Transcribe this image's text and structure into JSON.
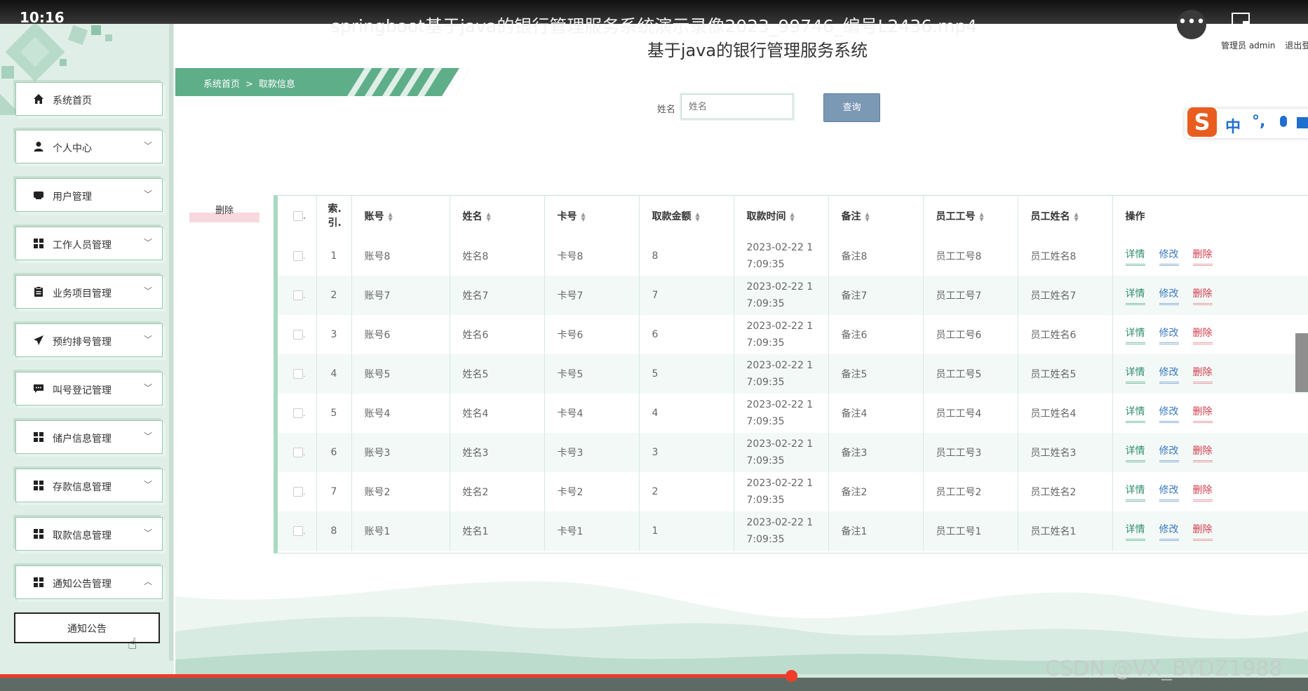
{
  "video": {
    "time": "10:16",
    "title": "springboot基于java的银行管理服务系统演示录像2023_99746_编号L2436.mp4",
    "progress_percent": 60.5
  },
  "header": {
    "site_title": "基于java的银行管理服务系统",
    "admin_text": "管理员 admin",
    "logout_text": "退出登"
  },
  "breadcrumb": {
    "home": "系统首页",
    "separator": ">",
    "current": "取款信息"
  },
  "search": {
    "label": "姓名",
    "placeholder": "姓名",
    "button": "查询"
  },
  "toolbar": {
    "batch_delete": "删除"
  },
  "sidebar": {
    "items": [
      {
        "label": "系统首页",
        "icon": "home-icon"
      },
      {
        "label": "个人中心",
        "icon": "user-icon"
      },
      {
        "label": "用户管理",
        "icon": "users-icon"
      },
      {
        "label": "工作人员管理",
        "icon": "grid-icon"
      },
      {
        "label": "业务项目管理",
        "icon": "clipboard-icon"
      },
      {
        "label": "预约排号管理",
        "icon": "send-icon"
      },
      {
        "label": "叫号登记管理",
        "icon": "message-icon"
      },
      {
        "label": "储户信息管理",
        "icon": "grid-icon"
      },
      {
        "label": "存款信息管理",
        "icon": "grid-icon"
      },
      {
        "label": "取款信息管理",
        "icon": "grid-icon"
      },
      {
        "label": "通知公告管理",
        "icon": "grid-icon"
      }
    ],
    "sub_item": "通知公告"
  },
  "table": {
    "headers": [
      "索引",
      "账号",
      "姓名",
      "卡号",
      "取款金额",
      "取款时间",
      "备注",
      "员工工号",
      "员工姓名",
      "操作"
    ],
    "index_header_lines": [
      "索.",
      "引."
    ],
    "actions": {
      "detail": "详情",
      "edit": "修改",
      "delete": "删除"
    },
    "rows": [
      {
        "index": "1",
        "account": "账号8",
        "name": "姓名8",
        "card": "卡号8",
        "amount": "8",
        "time1": "2023-02-22 1",
        "time2": "7:09:35",
        "note": "备注8",
        "emp_no": "员工工号8",
        "emp_name": "员工姓名8"
      },
      {
        "index": "2",
        "account": "账号7",
        "name": "姓名7",
        "card": "卡号7",
        "amount": "7",
        "time1": "2023-02-22 1",
        "time2": "7:09:35",
        "note": "备注7",
        "emp_no": "员工工号7",
        "emp_name": "员工姓名7"
      },
      {
        "index": "3",
        "account": "账号6",
        "name": "姓名6",
        "card": "卡号6",
        "amount": "6",
        "time1": "2023-02-22 1",
        "time2": "7:09:35",
        "note": "备注6",
        "emp_no": "员工工号6",
        "emp_name": "员工姓名6"
      },
      {
        "index": "4",
        "account": "账号5",
        "name": "姓名5",
        "card": "卡号5",
        "amount": "5",
        "time1": "2023-02-22 1",
        "time2": "7:09:35",
        "note": "备注5",
        "emp_no": "员工工号5",
        "emp_name": "员工姓名5"
      },
      {
        "index": "5",
        "account": "账号4",
        "name": "姓名4",
        "card": "卡号4",
        "amount": "4",
        "time1": "2023-02-22 1",
        "time2": "7:09:35",
        "note": "备注4",
        "emp_no": "员工工号4",
        "emp_name": "员工姓名4"
      },
      {
        "index": "6",
        "account": "账号3",
        "name": "姓名3",
        "card": "卡号3",
        "amount": "3",
        "time1": "2023-02-22 1",
        "time2": "7:09:35",
        "note": "备注3",
        "emp_no": "员工工号3",
        "emp_name": "员工姓名3"
      },
      {
        "index": "7",
        "account": "账号2",
        "name": "姓名2",
        "card": "卡号2",
        "amount": "2",
        "time1": "2023-02-22 1",
        "time2": "7:09:35",
        "note": "备注2",
        "emp_no": "员工工号2",
        "emp_name": "员工姓名2"
      },
      {
        "index": "8",
        "account": "账号1",
        "name": "姓名1",
        "card": "卡号1",
        "amount": "1",
        "time1": "2023-02-22 1",
        "time2": "7:09:35",
        "note": "备注1",
        "emp_no": "员工工号1",
        "emp_name": "员工姓名1"
      }
    ]
  },
  "ime": {
    "logo": "S",
    "mode": "中",
    "punct": "°,"
  },
  "watermark": "CSDN @VX_BYDZ1988",
  "colors": {
    "accent_green": "#5fae8a",
    "sidebar_bg": "#dfefe7",
    "search_button": "#7b98b4",
    "detail_link": "#2e8c6c",
    "edit_link": "#3b78c0",
    "delete_link": "#d43c4c",
    "progress": "#f23b2b"
  }
}
